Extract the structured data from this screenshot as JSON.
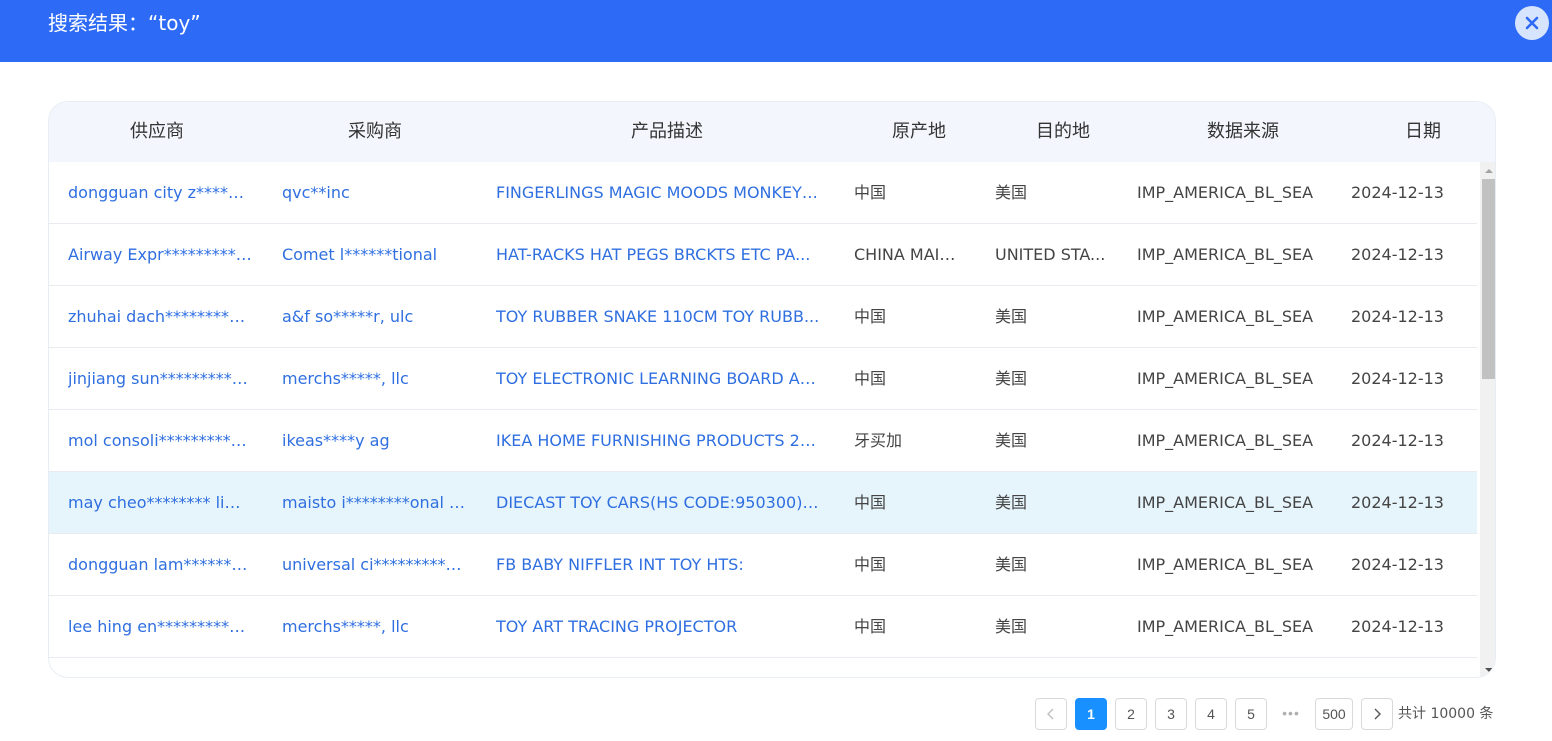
{
  "modal": {
    "title": "搜索结果：“toy”",
    "close_icon": "close-icon"
  },
  "table": {
    "columns": [
      "供应商",
      "采购商",
      "产品描述",
      "原产地",
      "目的地",
      "数据来源",
      "日期"
    ],
    "rows": [
      {
        "supplier": "dongguan city z*********...",
        "buyer": "qvc**inc",
        "description": "FINGERLINGS MAGIC MOODS MONKEY ...",
        "origin": "中国",
        "destination": "美国",
        "source": "IMP_AMERICA_BL_SEA",
        "date": "2024-12-13"
      },
      {
        "supplier": "Airway Expr**********on...",
        "buyer": "Comet l******tional",
        "description": "HAT-RACKS HAT PEGS BRCKTS ETC PA...",
        "origin": "CHINA MAIN...",
        "destination": "UNITED STA...",
        "source": "IMP_AMERICA_BL_SEA",
        "date": "2024-12-13"
      },
      {
        "supplier": "zhuhai dach***********&...",
        "buyer": "a&f so*****r, ulc",
        "description": "TOY RUBBER SNAKE 110CM TOY RUBB...",
        "origin": "中国",
        "destination": "美国",
        "source": "IMP_AMERICA_BL_SEA",
        "date": "2024-12-13"
      },
      {
        "supplier": "jinjiang sun***********on...",
        "buyer": "merchs*****, llc",
        "description": "TOY ELECTRONIC LEARNING BOARD AL...",
        "origin": "中国",
        "destination": "美国",
        "source": "IMP_AMERICA_BL_SEA",
        "date": "2024-12-13"
      },
      {
        "supplier": "mol consoli***********ic...",
        "buyer": "ikeas****y ag",
        "description": "IKEA HOME FURNISHING PRODUCTS 21...",
        "origin": "牙买加",
        "destination": "美国",
        "source": "IMP_AMERICA_BL_SEA",
        "date": "2024-12-13"
      },
      {
        "supplier": "may cheo******** limited",
        "buyer": "maisto i********onal inc",
        "description": "DIECAST TOY CARS(HS CODE:950300) ...",
        "origin": "中国",
        "destination": "美国",
        "source": "IMP_AMERICA_BL_SEA",
        "date": "2024-12-13"
      },
      {
        "supplier": "dongguan lam**********...",
        "buyer": "universal ci***********en...",
        "description": "FB BABY NIFFLER INT TOY HTS:",
        "origin": "中国",
        "destination": "美国",
        "source": "IMP_AMERICA_BL_SEA",
        "date": "2024-12-13"
      },
      {
        "supplier": "lee hing en***********in...",
        "buyer": "merchs*****, llc",
        "description": "TOY ART TRACING PROJECTOR",
        "origin": "中国",
        "destination": "美国",
        "source": "IMP_AMERICA_BL_SEA",
        "date": "2024-12-13"
      }
    ]
  },
  "pagination": {
    "pages": [
      "1",
      "2",
      "3",
      "4",
      "5"
    ],
    "current": "1",
    "ellipsis": "•••",
    "last": "500",
    "total": "共计 10000 条"
  },
  "colors": {
    "header_bg": "#2d6af6",
    "link": "#2f6fe0",
    "active_page": "#1890ff",
    "highlight_row": "#e6f4fc"
  }
}
